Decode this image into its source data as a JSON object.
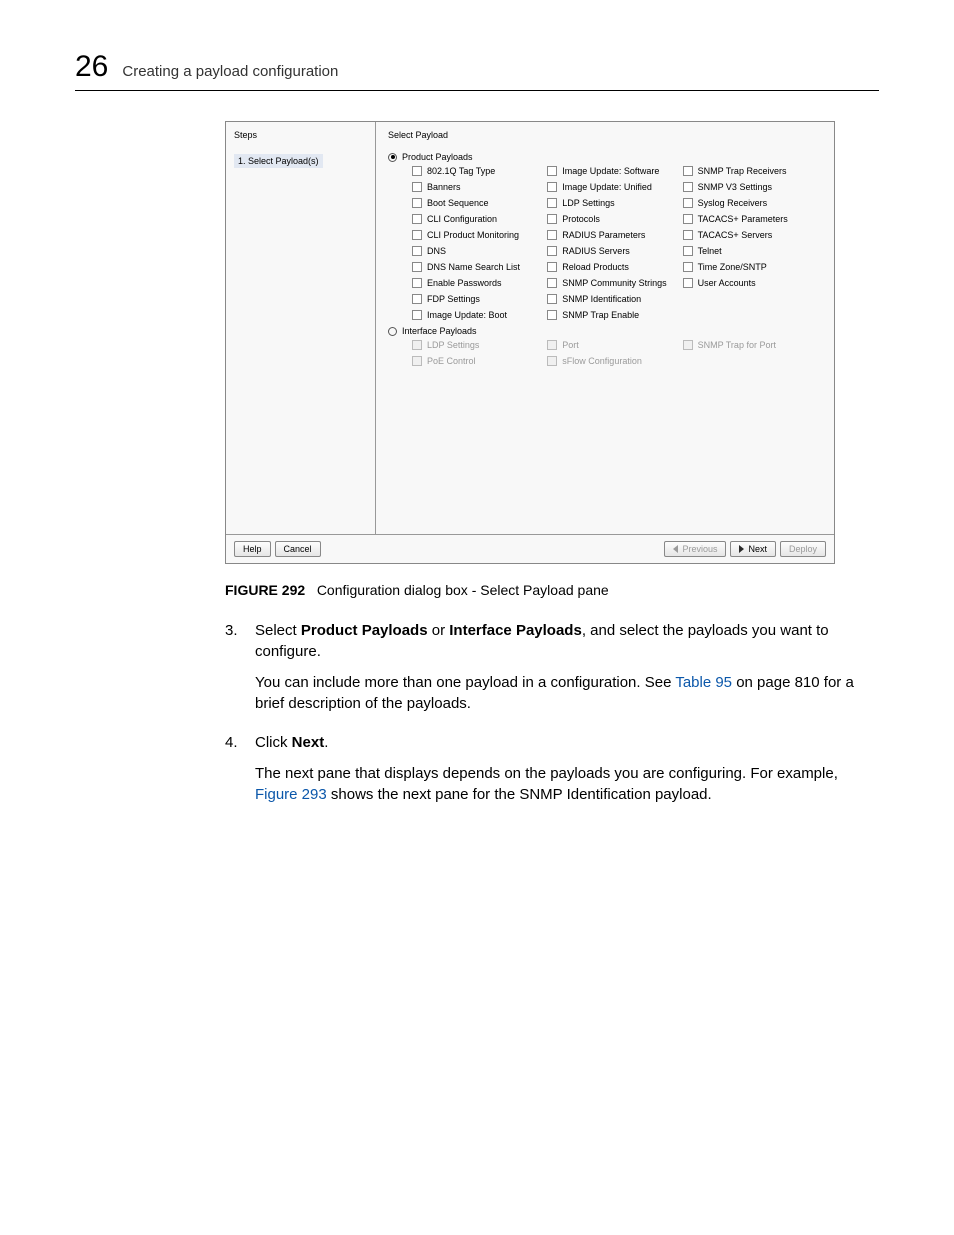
{
  "page": {
    "number": "26",
    "title": "Creating a payload configuration"
  },
  "dialog": {
    "steps_title": "Steps",
    "step1": "1. Select Payload(s)",
    "pane_title": "Select Payload",
    "radio_product": "Product Payloads",
    "radio_interface": "Interface Payloads",
    "product_col1": [
      "802.1Q Tag Type",
      "Banners",
      "Boot Sequence",
      "CLI Configuration",
      "CLI Product Monitoring",
      "DNS",
      "DNS Name Search List",
      "Enable Passwords",
      "FDP Settings",
      "Image Update: Boot"
    ],
    "product_col2": [
      "Image Update: Software",
      "Image Update: Unified",
      "LDP Settings",
      "Protocols",
      "RADIUS Parameters",
      "RADIUS Servers",
      "Reload Products",
      "SNMP Community Strings",
      "SNMP Identification",
      "SNMP Trap Enable"
    ],
    "product_col3": [
      "SNMP Trap Receivers",
      "SNMP V3 Settings",
      "Syslog Receivers",
      "TACACS+ Parameters",
      "TACACS+ Servers",
      "Telnet",
      "Time Zone/SNTP",
      "User Accounts"
    ],
    "interface_col1": [
      "LDP Settings",
      "PoE Control"
    ],
    "interface_col2": [
      "Port",
      "sFlow Configuration"
    ],
    "interface_col3": [
      "SNMP Trap for Port"
    ],
    "btn_help": "Help",
    "btn_cancel": "Cancel",
    "btn_previous": "Previous",
    "btn_next": "Next",
    "btn_deploy": "Deploy"
  },
  "figure": {
    "label": "FIGURE 292",
    "caption": "Configuration dialog box - Select Payload pane"
  },
  "body": {
    "step3_num": "3.",
    "step3_a": "Select ",
    "step3_b": "Product Payloads",
    "step3_c": " or ",
    "step3_d": "Interface Payloads",
    "step3_e": ", and select the payloads you want to configure.",
    "step3_para_a": "You can include more than one payload in a configuration. See ",
    "step3_para_link": "Table 95",
    "step3_para_b": " on page 810 for a brief description of the payloads.",
    "step4_num": "4.",
    "step4_a": "Click ",
    "step4_b": "Next",
    "step4_c": ".",
    "step4_para_a": "The next pane that displays depends on the payloads you are configuring. For example, ",
    "step4_para_link": "Figure 293",
    "step4_para_b": " shows the next pane for the SNMP Identification payload."
  }
}
